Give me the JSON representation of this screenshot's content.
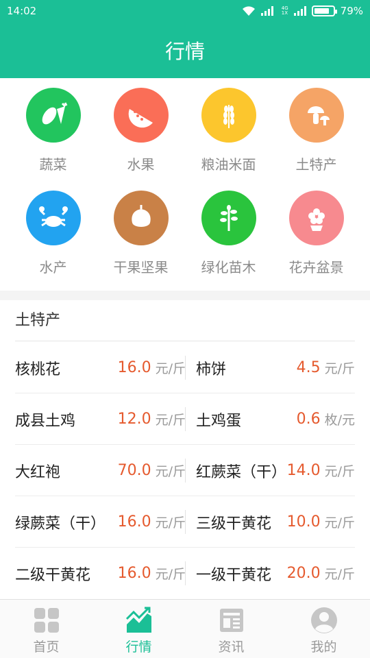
{
  "status_bar": {
    "time": "14:02",
    "network": "4G\n1X",
    "battery": "79%",
    "battery_level": 0.79
  },
  "header": {
    "title": "行情"
  },
  "colors": {
    "primary": "#1bbf96",
    "price": "#e55a2e"
  },
  "categories": [
    {
      "label": "蔬菜",
      "icon": "vegetable-icon",
      "color": "#22c55e"
    },
    {
      "label": "水果",
      "icon": "watermelon-icon",
      "color": "#fa6e57"
    },
    {
      "label": "粮油米面",
      "icon": "wheat-icon",
      "color": "#fcc62d"
    },
    {
      "label": "土特产",
      "icon": "mushroom-icon",
      "color": "#f5a466"
    },
    {
      "label": "水产",
      "icon": "crab-icon",
      "color": "#22a3f0"
    },
    {
      "label": "干果坚果",
      "icon": "nut-icon",
      "color": "#c98147"
    },
    {
      "label": "绿化苗木",
      "icon": "tree-icon",
      "color": "#2ac43d"
    },
    {
      "label": "花卉盆景",
      "icon": "flower-icon",
      "color": "#f78a8f"
    }
  ],
  "section": {
    "title": "土特产",
    "rows": [
      [
        {
          "name": "核桃花",
          "price": "16.0",
          "unit": "元/斤"
        },
        {
          "name": "柿饼",
          "price": "4.5",
          "unit": "元/斤"
        }
      ],
      [
        {
          "name": "成县土鸡",
          "price": "12.0",
          "unit": "元/斤"
        },
        {
          "name": "土鸡蛋",
          "price": "0.6",
          "unit": "枚/元"
        }
      ],
      [
        {
          "name": "大红袍",
          "price": "70.0",
          "unit": "元/斤"
        },
        {
          "name": "红蕨菜（干）",
          "price": "14.0",
          "unit": "元/斤"
        }
      ],
      [
        {
          "name": "绿蕨菜（干）",
          "price": "16.0",
          "unit": "元/斤"
        },
        {
          "name": "三级干黄花",
          "price": "10.0",
          "unit": "元/斤"
        }
      ],
      [
        {
          "name": "二级干黄花",
          "price": "16.0",
          "unit": "元/斤"
        },
        {
          "name": "一级干黄花",
          "price": "20.0",
          "unit": "元/斤"
        }
      ]
    ]
  },
  "nav": {
    "items": [
      {
        "label": "首页",
        "icon": "home-grid-icon"
      },
      {
        "label": "行情",
        "icon": "chart-icon",
        "active": true
      },
      {
        "label": "资讯",
        "icon": "news-icon"
      },
      {
        "label": "我的",
        "icon": "profile-icon"
      }
    ]
  }
}
